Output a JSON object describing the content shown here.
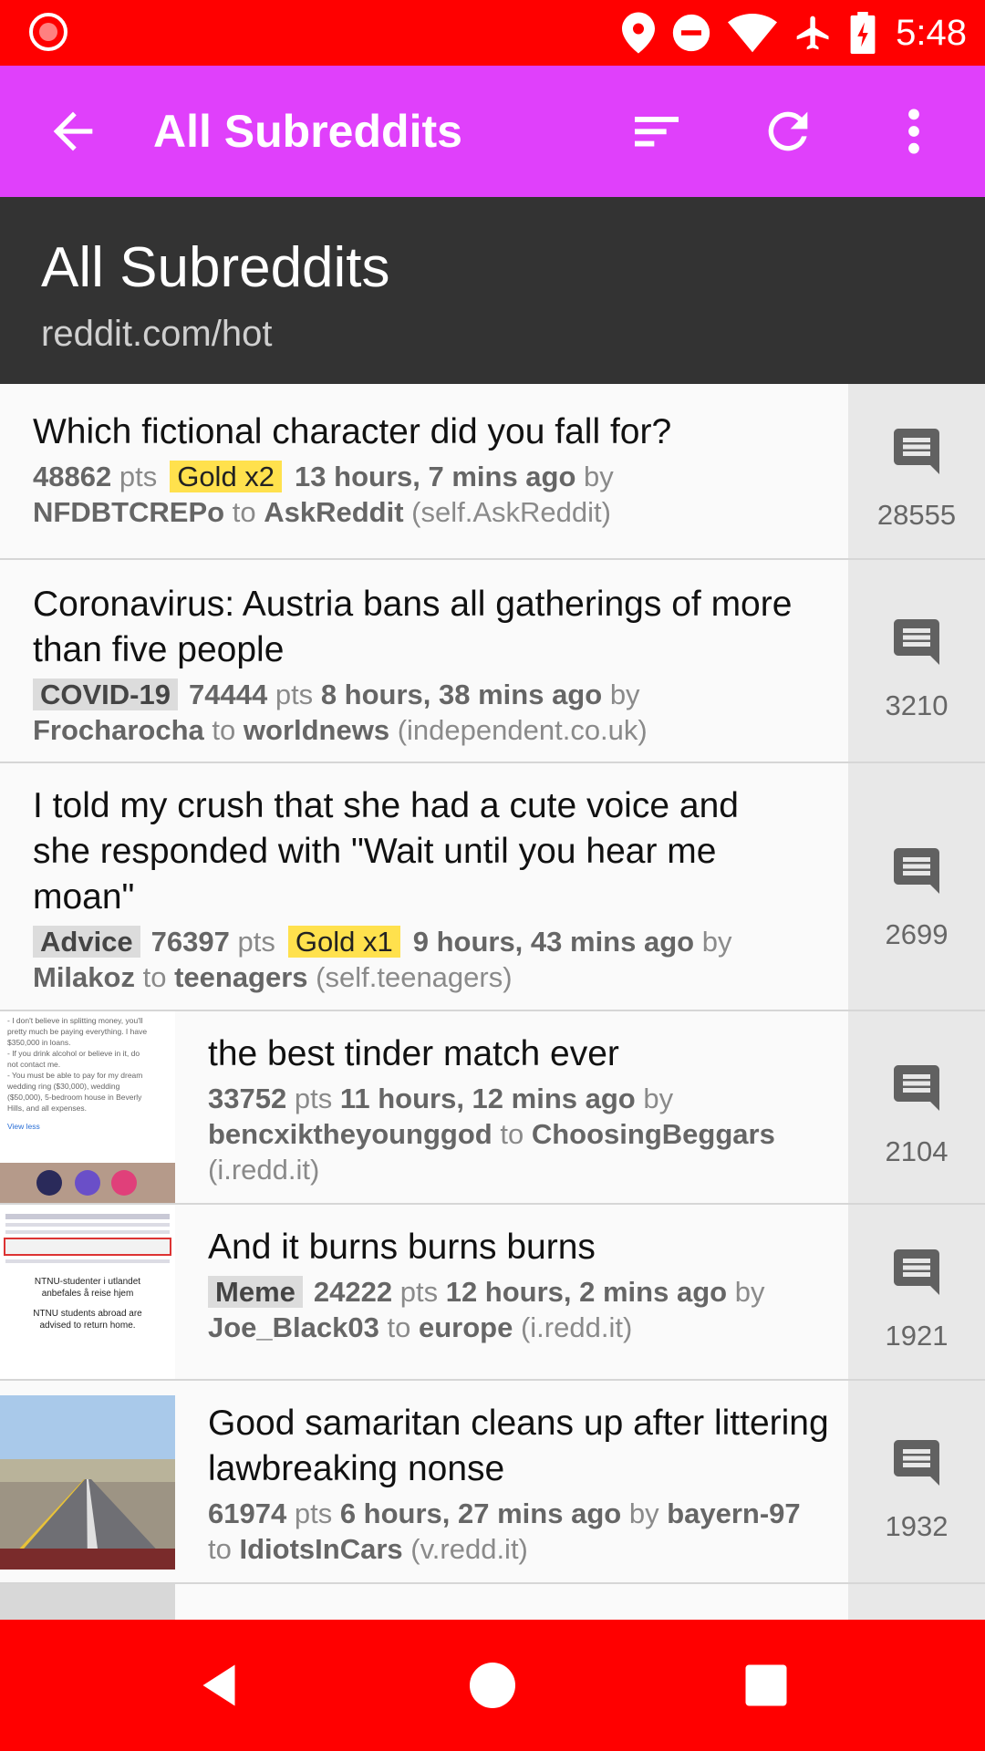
{
  "status_bar": {
    "time": "5:48",
    "icons": [
      "record-icon",
      "location-icon",
      "do-not-disturb-icon",
      "wifi-icon",
      "airplane-icon",
      "battery-charging-icon"
    ]
  },
  "app_bar": {
    "title": "All Subreddits",
    "icons": [
      "back-arrow-icon",
      "sort-icon",
      "refresh-icon",
      "more-vert-icon"
    ],
    "color": "#e040fb"
  },
  "header": {
    "title": "All Subreddits",
    "subtitle": "reddit.com/hot"
  },
  "posts": [
    {
      "title": "Which fictional character did you fall for?",
      "flair": "",
      "points": "48862",
      "pts_label": "pts",
      "gold": "Gold x2",
      "time": "13 hours, 7 mins ago",
      "by": "by",
      "author": "NFDBTCREPo",
      "to": "to",
      "subreddit": "AskReddit",
      "domain": "(self.AskReddit)",
      "comments": "28555"
    },
    {
      "title": "Coronavirus: Austria bans all gatherings of more than five people",
      "flair": "COVID-19",
      "points": "74444",
      "pts_label": "pts",
      "gold": "",
      "time": "8 hours, 38 mins ago",
      "by": "by",
      "author": "Frocharocha",
      "to": "to",
      "subreddit": "worldnews",
      "domain": "(independent.co.uk)",
      "comments": "3210"
    },
    {
      "title": "I told my crush that she had a cute voice and she responded with \"Wait until you hear me moan\"",
      "flair": "Advice",
      "points": "76397",
      "pts_label": "pts",
      "gold": "Gold x1",
      "time": "9 hours, 43 mins ago",
      "by": "by",
      "author": "Milakoz",
      "to": "to",
      "subreddit": "teenagers",
      "domain": "(self.teenagers)",
      "comments": "2699"
    },
    {
      "title": "the best tinder match ever",
      "flair": "",
      "points": "33752",
      "pts_label": "pts",
      "gold": "",
      "time": "11 hours, 12 mins ago",
      "by": "by",
      "author": "bencxiktheyounggod",
      "to": "to",
      "subreddit": "ChoosingBeggars",
      "domain": "(i.redd.it)",
      "comments": "2104",
      "thumb_text": [
        "- I don't believe in splitting money, you'll",
        "pretty much be paying everything. I have",
        "$350,000 in loans.",
        "- If you drink alcohol or believe in it, do",
        "not contact me.",
        "- You must be able to pay for my dream",
        "wedding ring ($30,000), wedding",
        "($50,000), 5-bedroom house in Beverly",
        "Hills, and all expenses.",
        "View less"
      ]
    },
    {
      "title": "And it burns burns burns",
      "flair": "Meme",
      "points": "24222",
      "pts_label": "pts",
      "gold": "",
      "time": "12 hours, 2 mins ago",
      "by": "by",
      "author": "Joe_Black03",
      "to": "to",
      "subreddit": "europe",
      "domain": "(i.redd.it)",
      "comments": "1921",
      "thumb_text": [
        "NTNU-studenter i utlandet",
        "anbefales å reise hjem",
        "NTNU students abroad are",
        "advised to return home."
      ]
    },
    {
      "title": "Good samaritan cleans up after littering lawbreaking nonse",
      "flair": "",
      "points": "61974",
      "pts_label": "pts",
      "gold": "",
      "time": "6 hours, 27 mins ago",
      "by": "by",
      "author": "bayern-97",
      "to": "to",
      "subreddit": "IdiotsInCars",
      "domain": "(v.redd.it)",
      "comments": "1932"
    }
  ],
  "comment_icon": "comment-icon",
  "nav_bar": {
    "icons": [
      "back-triangle-icon",
      "home-circle-icon",
      "recents-square-icon"
    ],
    "color": "#ff0000"
  }
}
